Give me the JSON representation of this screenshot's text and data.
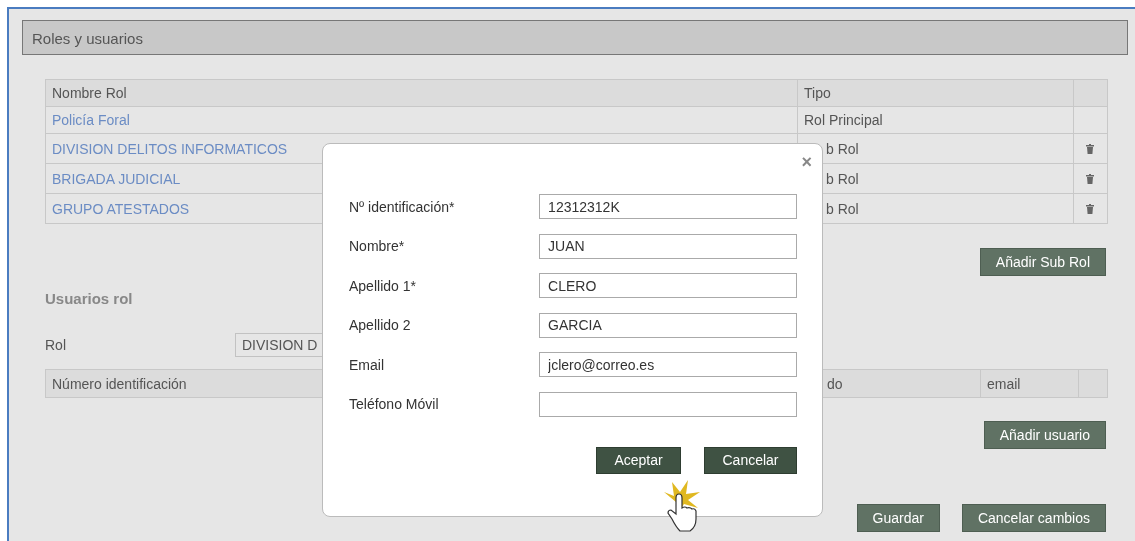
{
  "panel": {
    "title": "Roles y usuarios"
  },
  "roles_table": {
    "columns": [
      "Nombre Rol",
      "Tipo"
    ],
    "rows": [
      {
        "name": "Policía Foral",
        "tipo": "Rol Principal",
        "kind": "principal"
      },
      {
        "name": "DIVISION DELITOS INFORMATICOS",
        "tipo": "b Rol",
        "kind": "sub"
      },
      {
        "name": "BRIGADA JUDICIAL",
        "tipo": "b Rol",
        "kind": "sub"
      },
      {
        "name": "GRUPO ATESTADOS",
        "tipo": "b Rol",
        "kind": "sub"
      }
    ]
  },
  "add_subrole_button": "Añadir Sub Rol",
  "users_section": {
    "title": "Usuarios rol",
    "rol_label": "Rol",
    "rol_value": "DIVISION D",
    "columns": [
      "Número identificación",
      "do",
      "email"
    ],
    "add_user_button": "Añadir usuario"
  },
  "footer_buttons": [
    "Guardar",
    "Cancelar cambios"
  ],
  "dialog": {
    "close": "×",
    "fields": [
      {
        "label": "Nº identificación*",
        "value": "12312312K"
      },
      {
        "label": "Nombre*",
        "value": "JUAN"
      },
      {
        "label": "Apellido 1*",
        "value": "CLERO"
      },
      {
        "label": "Apellido 2",
        "value": "GARCIA"
      },
      {
        "label": "Email",
        "value": "jclero@correo.es"
      },
      {
        "label": "Teléfono Móvil"
      }
    ],
    "buttons": [
      "Aceptar",
      "Cancelar"
    ]
  }
}
